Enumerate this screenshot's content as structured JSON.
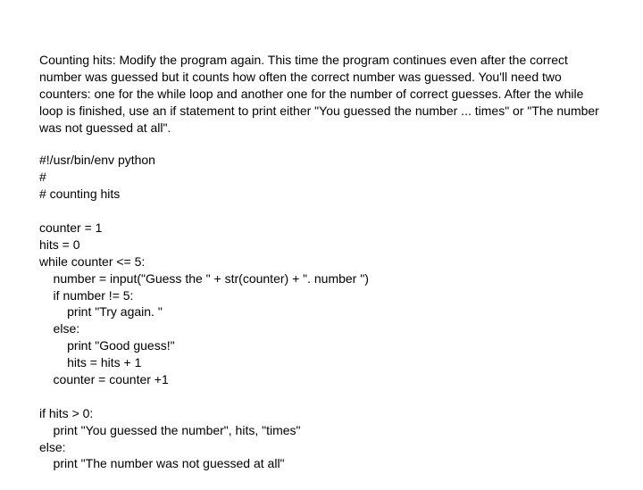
{
  "instruction": "Counting hits: Modify the program again. This time the program continues even after the correct number was guessed but it counts how often the correct number was guessed. You'll need two counters: one for the while loop and another one for the number of correct guesses. After the while loop is finished, use an if statement to print either \"You guessed the number ... times\" or \"The number was not guessed at all\".",
  "code": "#!/usr/bin/env python\n#\n# counting hits\n\ncounter = 1\nhits = 0\nwhile counter <= 5:\n    number = input(\"Guess the \" + str(counter) + \". number \")\n    if number != 5:\n        print \"Try again. \"\n    else:\n        print \"Good guess!\"\n        hits = hits + 1\n    counter = counter +1\n\nif hits > 0:\n    print \"You guessed the number\", hits, \"times\"\nelse:\n    print \"The number was not guessed at all\""
}
